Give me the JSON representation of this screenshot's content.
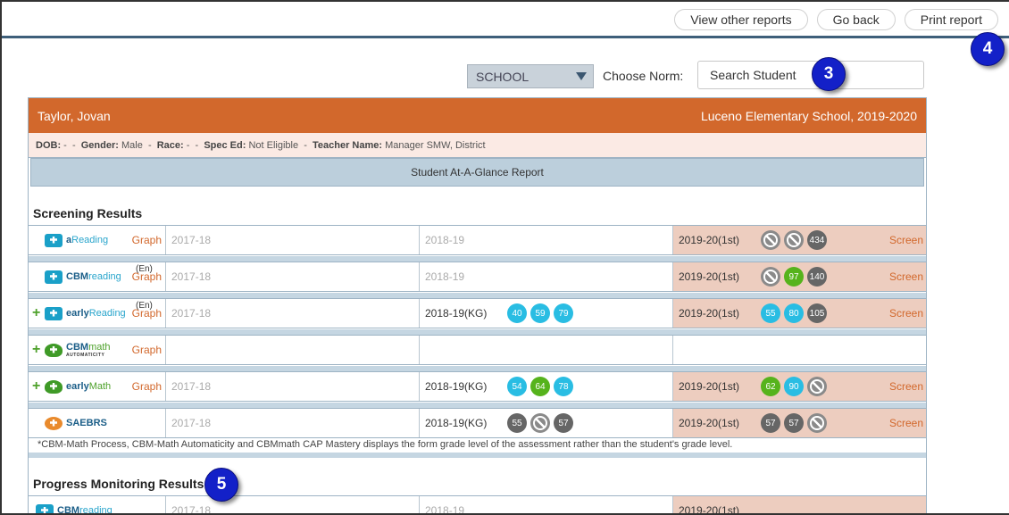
{
  "topbar": {
    "view_other": "View other reports",
    "go_back": "Go back",
    "print": "Print report"
  },
  "badges": {
    "b3": "3",
    "b4": "4",
    "b5": "5"
  },
  "filters": {
    "school_select": "SCHOOL",
    "norm_label": "Choose Norm:",
    "search_placeholder": "Search Student"
  },
  "student": {
    "name": "Taylor, Jovan",
    "school_year": "Luceno Elementary School, 2019-2020",
    "dob_label": "DOB:",
    "dob": "-",
    "gender_label": "Gender:",
    "gender": "Male",
    "race_label": "Race:",
    "race": "-",
    "sped_label": "Spec Ed:",
    "sped": "Not Eligible",
    "teacher_label": "Teacher Name:",
    "teacher": "Manager SMW, District"
  },
  "report_title": "Student At-A-Glance Report",
  "screening_title": "Screening Results",
  "progress_title": "Progress Monitoring Results",
  "graph_label": "Graph",
  "screen_label": "Screen",
  "en_tag": "(En)",
  "rows": [
    {
      "name_bold": "a",
      "name_hl": "Reading",
      "y1": "2017-18",
      "y2": "2018-19",
      "y3": "2019-20(1st)"
    },
    {
      "name_bold": "CBM",
      "name_hl": "reading",
      "y1": "2017-18",
      "y2": "2018-19",
      "y3": "2019-20(1st)"
    },
    {
      "name_bold": "early",
      "name_hl": "Reading",
      "y1": "2017-18",
      "y2": "2018-19(KG)",
      "y3": "2019-20(1st)"
    },
    {
      "name_bold": "CBM",
      "name_hl": "math",
      "sub": "AUTOMATICITY"
    },
    {
      "name_bold": "early",
      "name_hl": "Math",
      "y1": "2017-18",
      "y2": "2018-19(KG)",
      "y3": "2019-20(1st)"
    },
    {
      "name_bold": "SAE",
      "name_hl": "BRS",
      "y1": "2017-18",
      "y2": "2018-19(KG)",
      "y3": "2019-20(1st)"
    }
  ],
  "scores": {
    "r0_y3": [
      "",
      "",
      "434"
    ],
    "r1_y3": [
      "",
      "97",
      "140"
    ],
    "r2_y2": [
      "40",
      "59",
      "79"
    ],
    "r2_y3": [
      "55",
      "80",
      "105"
    ],
    "r4_y2": [
      "54",
      "64",
      "78"
    ],
    "r4_y3": [
      "62",
      "90",
      ""
    ],
    "r5_y2": [
      "55",
      "",
      "57"
    ],
    "r5_y3": [
      "57",
      "57",
      ""
    ]
  },
  "footnote": "*CBM-Math Process, CBM-Math Automaticity and CBMmath CAP Mastery displays the form grade level of the assessment rather than the student's grade level.",
  "pm_row": {
    "name_bold": "CBM",
    "name_hl": "reading",
    "y1": "2017-18",
    "y2": "2018-19",
    "y3": "2019-20(1st)"
  },
  "colors": {
    "accent": "#d2682c",
    "nav_line": "#3e5f7a",
    "badge": "#1320c8"
  }
}
